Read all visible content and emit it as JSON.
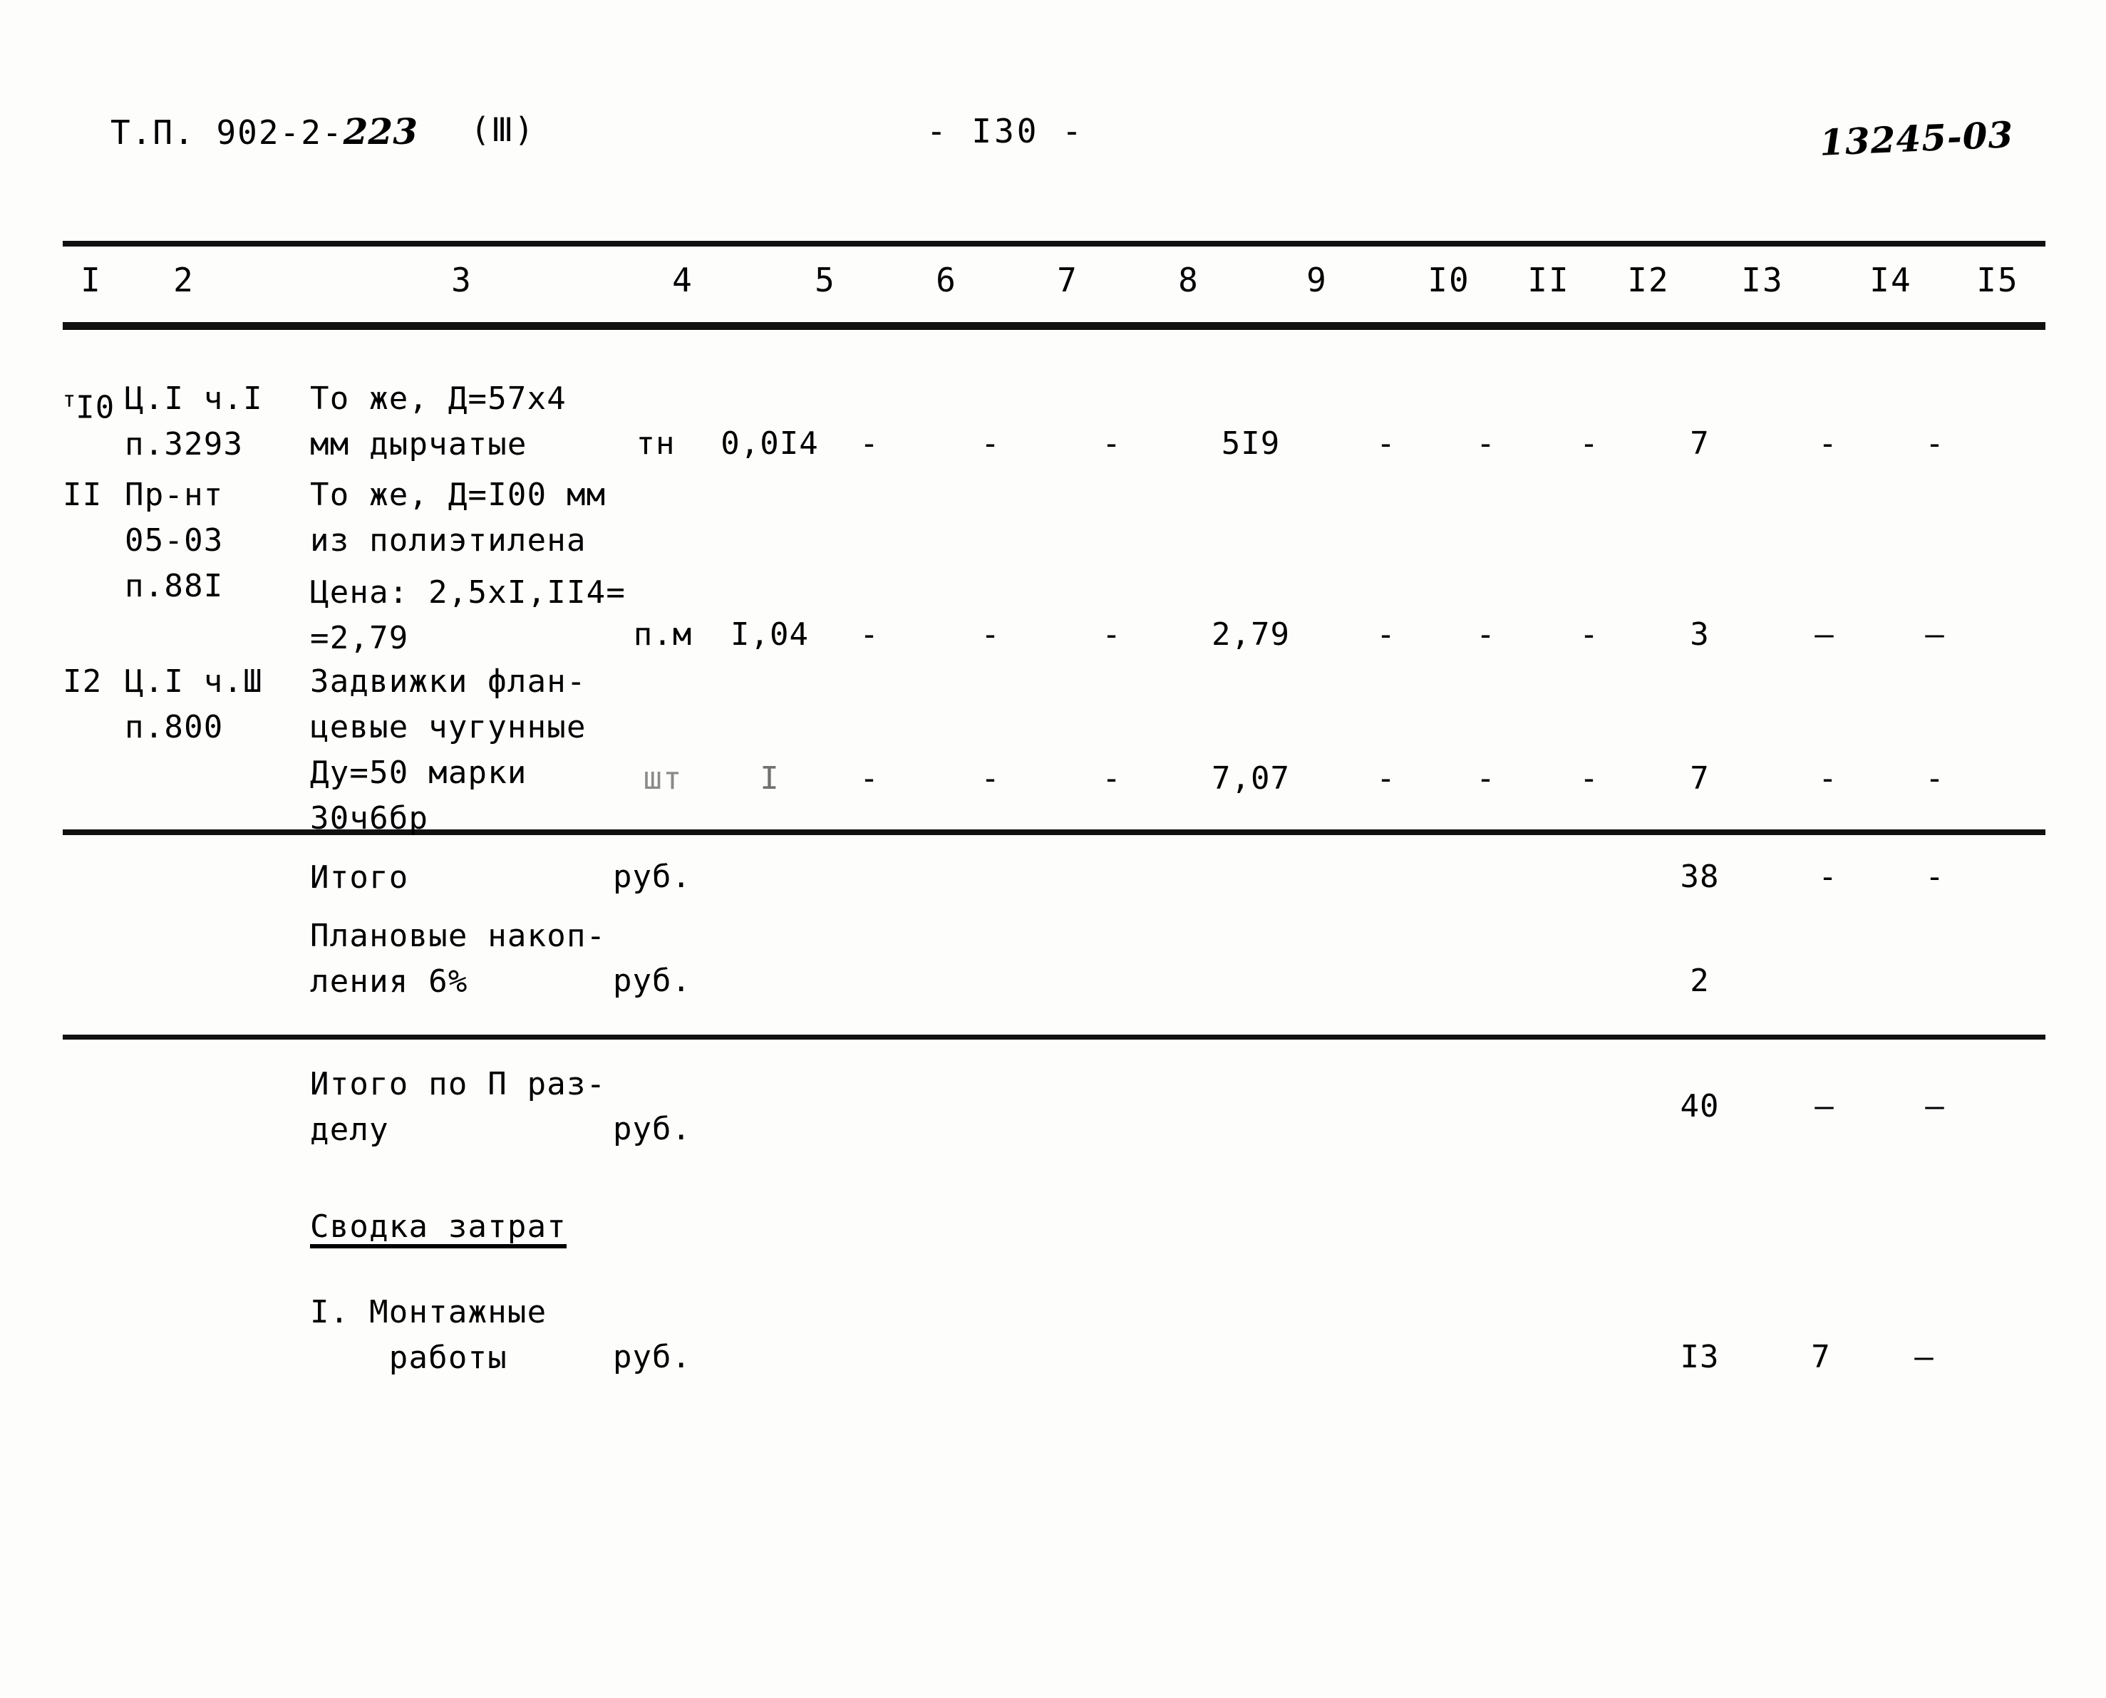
{
  "header": {
    "doc_prefix": "Т.П. 902-2-",
    "doc_number_hand": "223",
    "part": "(Ⅲ)",
    "page_label": "- I30 -",
    "corner_stamp": "13245-03"
  },
  "table": {
    "column_headers": [
      "I",
      "2",
      "3",
      "4",
      "5",
      "6",
      "7",
      "8",
      "9",
      "I0",
      "II",
      "I2",
      "I3",
      "I4",
      "I5"
    ],
    "rows": [
      {
        "no": "I0",
        "justification": "Ц.I ч.I\nп.3293",
        "description": "Тo же, Д=57х4\nмм дырчатые",
        "unit": "тн",
        "c5": "0,0I4",
        "c6": "-",
        "c7": "-",
        "c8": "-",
        "c9": "5I9",
        "c10": "-",
        "c11": "-",
        "c12": "-",
        "c13": "7",
        "c14": "-",
        "c15": "-"
      },
      {
        "no": "II",
        "justification": "Пр-нт\n05-03\nп.88I",
        "description": "То же, Д=I00 мм\nиз полиэтилена",
        "description2": "Цена: 2,5хI,II4=\n=2,79",
        "unit": "п.м",
        "c5": "I,04",
        "c6": "-",
        "c7": "-",
        "c8": "-",
        "c9": "2,79",
        "c10": "-",
        "c11": "-",
        "c12": "-",
        "c13": "3",
        "c14": "—",
        "c15": "—"
      },
      {
        "no": "I2",
        "justification": "Ц.I ч.Ш\nп.800",
        "description": "Задвижки флан-\nцевые чугунные\nДу=50 марки\n30ч6бр",
        "unit": "шт",
        "c5": "I",
        "c6": "-",
        "c7": "-",
        "c8": "-",
        "c9": "7,07",
        "c10": "-",
        "c11": "-",
        "c12": "-",
        "c13": "7",
        "c14": "-",
        "c15": "-"
      }
    ],
    "summary_rows": [
      {
        "label": "Итого",
        "unit": "руб.",
        "c13": "38",
        "c14": "-",
        "c15": "-"
      },
      {
        "label": "Плановые накоп-\nления 6%",
        "unit": "руб.",
        "c13": "2",
        "c14": "",
        "c15": ""
      },
      {
        "label": "Итого по П раз-\nделу",
        "unit": "руб.",
        "c13": "40",
        "c14": "—",
        "c15": "—"
      }
    ],
    "costs_summary": {
      "title": "Сводка затрат",
      "items": [
        {
          "label": "I. Монтажные\n    работы",
          "unit": "руб.",
          "c13": "I3",
          "c14": "7",
          "c15": "—"
        }
      ]
    }
  }
}
